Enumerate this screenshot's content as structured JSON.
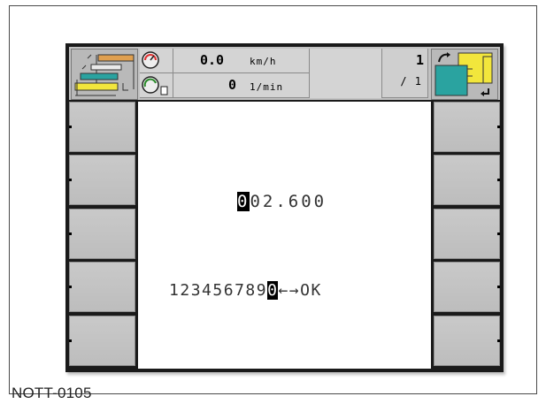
{
  "caption": "NOTT-0105",
  "status": {
    "speed_value": "0.0",
    "speed_unit": "km/h",
    "rpm_value": "0",
    "rpm_unit": "1/min",
    "counter_top": "1",
    "counter_bottom": "/ 1"
  },
  "input": {
    "cursor_digit": "0",
    "rest": "02.600"
  },
  "keypad": {
    "keys": [
      "1",
      "2",
      "3",
      "4",
      "5",
      "6",
      "7",
      "8",
      "9",
      "0",
      "←",
      "→",
      "OK"
    ],
    "selected_key": "0"
  },
  "colors": {
    "screen_border": "#1a1a1a",
    "softkey": "#c4c4c4",
    "icon_teal": "#2aa3a0",
    "icon_yellow": "#f2e63c",
    "icon_orange": "#e0a050"
  },
  "icons": [
    "implement-icon",
    "speedometer-icon",
    "rpm-gauge-icon",
    "implement-select-icon"
  ]
}
